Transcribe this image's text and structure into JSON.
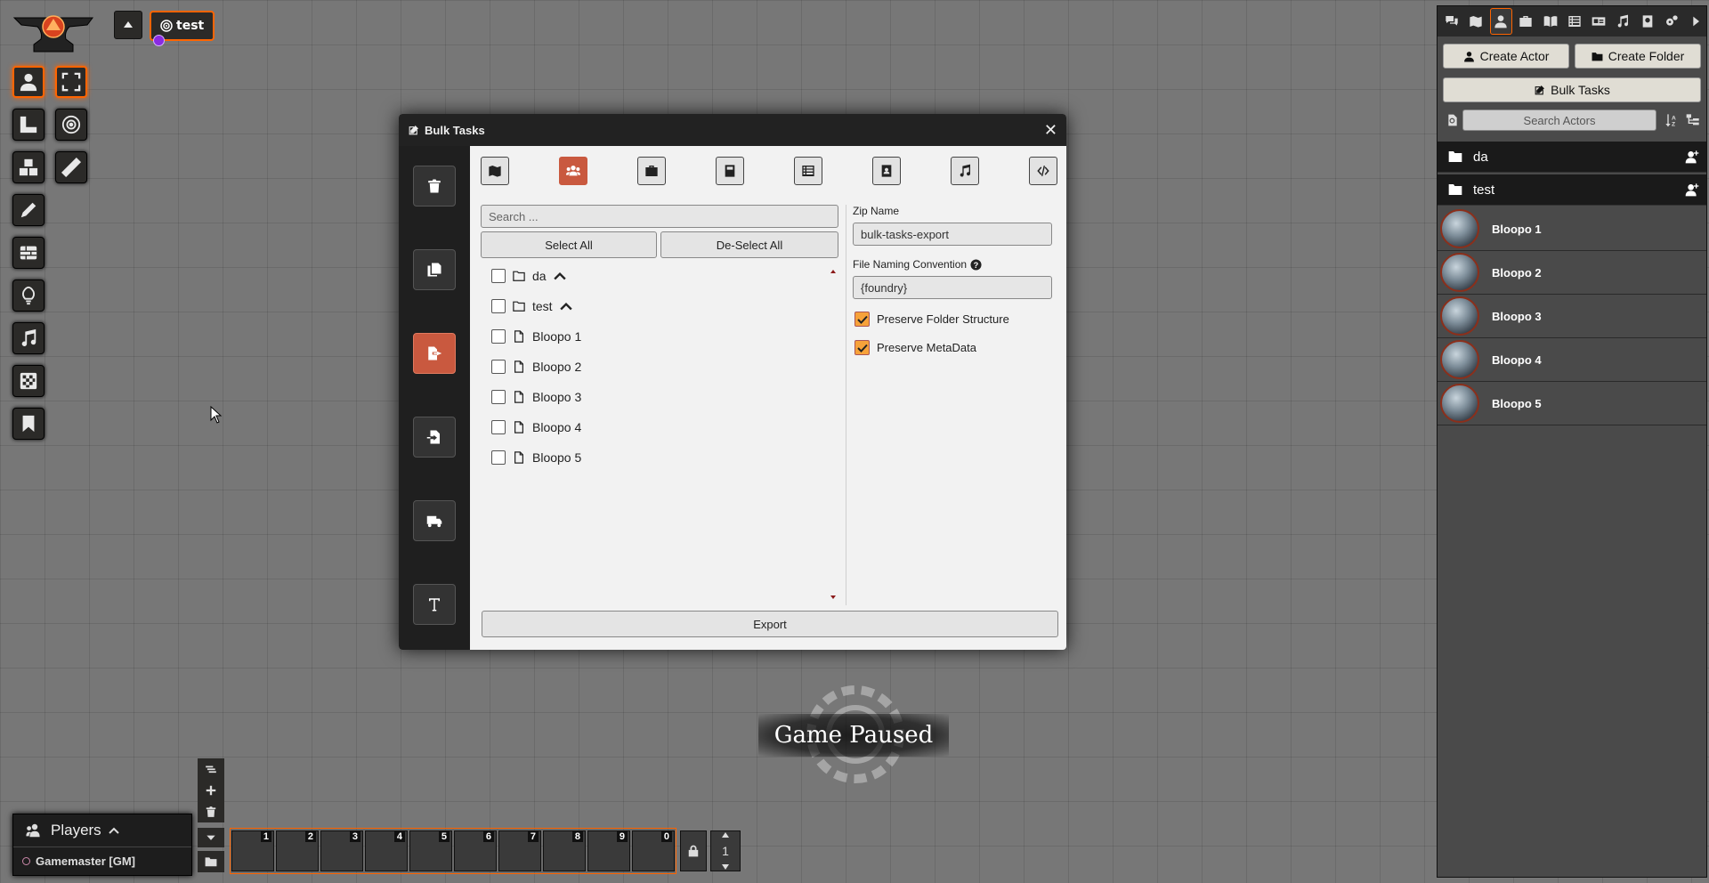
{
  "scene_nav": {
    "scene_name": "test"
  },
  "dialog": {
    "title": "Bulk Tasks",
    "search_placeholder": "Search ...",
    "select_all": "Select All",
    "deselect_all": "De-Select All",
    "items": [
      {
        "name": "da",
        "kind": "folder"
      },
      {
        "name": "test",
        "kind": "folder"
      },
      {
        "name": "Bloopo 1",
        "kind": "file"
      },
      {
        "name": "Bloopo 2",
        "kind": "file"
      },
      {
        "name": "Bloopo 3",
        "kind": "file"
      },
      {
        "name": "Bloopo 4",
        "kind": "file"
      },
      {
        "name": "Bloopo 5",
        "kind": "file"
      }
    ],
    "zip_label": "Zip Name",
    "zip_value": "bulk-tasks-export",
    "naming_label": "File Naming Convention",
    "naming_value": "{foundry}",
    "preserve_folder": "Preserve Folder Structure",
    "preserve_meta": "Preserve MetaData",
    "export_label": "Export"
  },
  "sidebar": {
    "create_actor": "Create Actor",
    "create_folder": "Create Folder",
    "bulk_tasks": "Bulk Tasks",
    "search_placeholder": "Search Actors",
    "folders": [
      "da",
      "test"
    ],
    "actors": [
      "Bloopo 1",
      "Bloopo 2",
      "Bloopo 3",
      "Bloopo 4",
      "Bloopo 5"
    ]
  },
  "players": {
    "title": "Players",
    "gm": "Gamemaster [GM]"
  },
  "hotbar": {
    "slots": [
      "1",
      "2",
      "3",
      "4",
      "5",
      "6",
      "7",
      "8",
      "9",
      "0"
    ],
    "page": "1"
  },
  "pause": {
    "text": "Game Paused"
  },
  "colors": {
    "accent": "#ff6400",
    "active_button": "#c9593f",
    "checkbox": "#f7a23a"
  }
}
